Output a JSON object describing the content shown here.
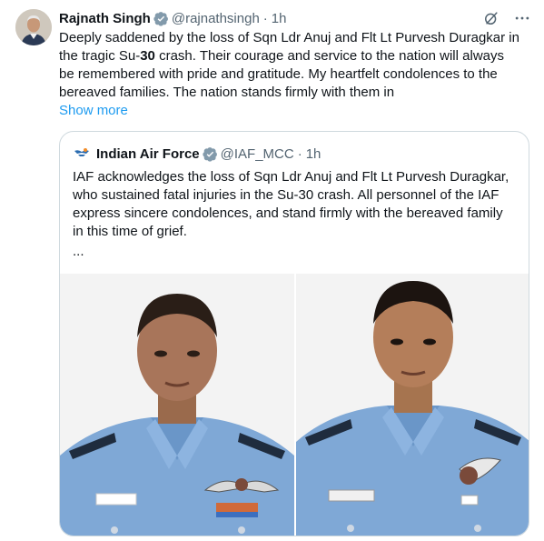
{
  "tweet": {
    "author_name": "Rajnath Singh",
    "handle": "@rajnathsingh",
    "separator": "·",
    "time": "1h",
    "text_line1": "Deeply saddened by the loss of Sqn Ldr Anuj and Flt Lt Purvesh Duragkar in",
    "text_line2_pre": "the tragic Su-",
    "text_line2_bold": "30",
    "text_line2_post": " crash. Their courage and service to the nation will always",
    "text_line3": "be remembered with pride and gratitude. My heartfelt condolences to the",
    "text_line4": "bereaved families. The nation stands firmly with them in",
    "show_more": "Show more"
  },
  "quote": {
    "author_name": "Indian Air Force",
    "handle": "@IAF_MCC",
    "separator": "·",
    "time": "1h",
    "text_line1": "IAF acknowledges the loss of Sqn Ldr Anuj and Flt Lt Purvesh Duragkar,",
    "text_line2": "who sustained fatal injuries in the Su-30 crash. All personnel of the IAF",
    "text_line3": "express sincere condolences, and stand firmly with the bereaved family",
    "text_line4": "in this time of grief.",
    "ellipsis": "..."
  },
  "icons": {
    "verified": "verified-badge-icon",
    "grok": "grok-icon",
    "more": "more-icon"
  },
  "colors": {
    "accent": "#1d9bf0",
    "muted": "#536471",
    "border": "#cfd9de",
    "uniform": "#7fa8d6"
  }
}
